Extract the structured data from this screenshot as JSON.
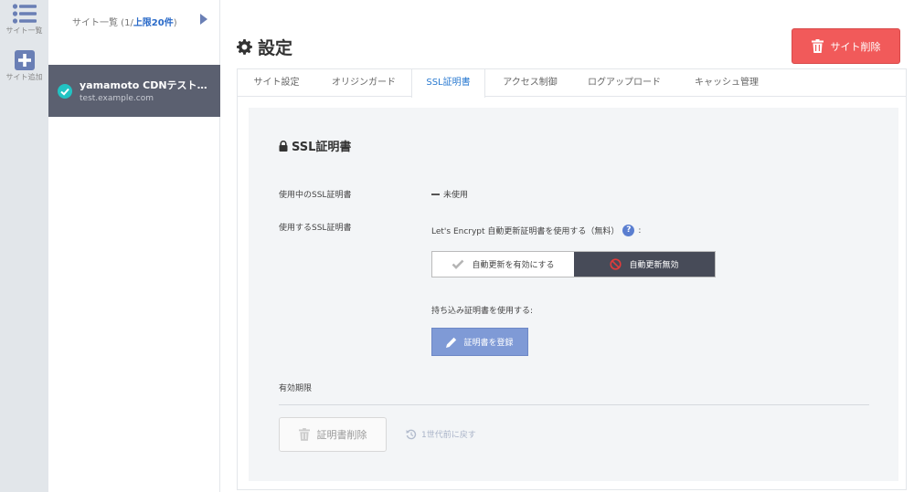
{
  "rail": {
    "items": [
      {
        "label": "サイト一覧",
        "icon": "list-icon"
      },
      {
        "label": "サイト追加",
        "icon": "plus-icon"
      }
    ]
  },
  "site_list": {
    "header_prefix": "サイト一覧 (1/",
    "header_limit": "上限20件",
    "header_suffix": ")",
    "sites": [
      {
        "name": "yamamoto CDNテストサイト",
        "host": "test.example.com"
      }
    ]
  },
  "header": {
    "title": "設定",
    "delete_site_label": "サイト削除"
  },
  "tabs": [
    {
      "label": "サイト設定",
      "active": false
    },
    {
      "label": "オリジンガード",
      "active": false
    },
    {
      "label": "SSL証明書",
      "active": true
    },
    {
      "label": "アクセス制御",
      "active": false
    },
    {
      "label": "ログアップロード",
      "active": false
    },
    {
      "label": "キャッシュ管理",
      "active": false
    }
  ],
  "ssl": {
    "section_title": "SSL証明書",
    "in_use_label": "使用中のSSL証明書",
    "in_use_value": "未使用",
    "use_label": "使用するSSL証明書",
    "lets_encrypt_label": "Let's Encrypt 自動更新証明書を使用する（無料）",
    "lets_encrypt_colon": ":",
    "help_mark": "?",
    "auto_on_label": "自動更新を有効にする",
    "auto_off_label": "自動更新無効",
    "auto_selected": "off",
    "import_label": "持ち込み証明書を使用する:",
    "register_label": "証明書を登録",
    "expiry_label": "有効期限",
    "cert_delete_label": "証明書削除",
    "revert_label": "1世代前に戻す"
  },
  "colors": {
    "accent": "#2a7ad0",
    "danger": "#f15a5a",
    "register": "#7f9ad6",
    "site_card": "#5b6070",
    "check": "#22c3c3"
  }
}
